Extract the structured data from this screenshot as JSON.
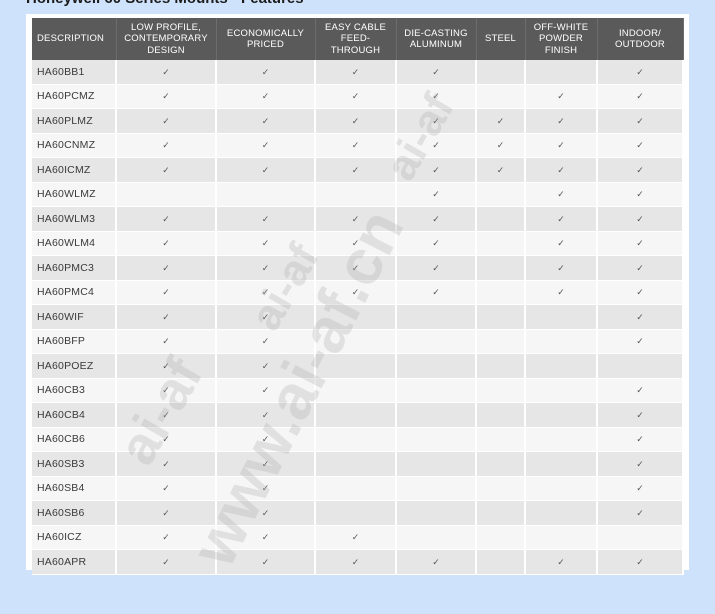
{
  "heading": "Honeywell 60 Series Mounts - Features",
  "table": {
    "columns": [
      "DESCRIPTION",
      "LOW PROFILE, CONTEMPORARY DESIGN",
      "ECONOMICALLY PRICED",
      "EASY CABLE FEED-THROUGH",
      "DIE-CASTING ALUMINUM",
      "STEEL",
      "OFF-WHITE POWDER FINISH",
      "INDOOR/ OUTDOOR"
    ],
    "check_symbol": "✓",
    "rows": [
      {
        "model": "HA60BB1",
        "checks": [
          1,
          1,
          1,
          1,
          0,
          0,
          1
        ]
      },
      {
        "model": "HA60PCMZ",
        "checks": [
          1,
          1,
          1,
          1,
          0,
          1,
          1
        ]
      },
      {
        "model": "HA60PLMZ",
        "checks": [
          1,
          1,
          1,
          1,
          1,
          1,
          1
        ]
      },
      {
        "model": "HA60CNMZ",
        "checks": [
          1,
          1,
          1,
          1,
          1,
          1,
          1
        ]
      },
      {
        "model": "HA60ICMZ",
        "checks": [
          1,
          1,
          1,
          1,
          1,
          1,
          1
        ]
      },
      {
        "model": "HA60WLMZ",
        "checks": [
          0,
          0,
          0,
          1,
          0,
          1,
          1
        ]
      },
      {
        "model": "HA60WLM3",
        "checks": [
          1,
          1,
          1,
          1,
          0,
          1,
          1
        ]
      },
      {
        "model": "HA60WLM4",
        "checks": [
          1,
          1,
          1,
          1,
          0,
          1,
          1
        ]
      },
      {
        "model": "HA60PMC3",
        "checks": [
          1,
          1,
          1,
          1,
          0,
          1,
          1
        ]
      },
      {
        "model": "HA60PMC4",
        "checks": [
          1,
          1,
          1,
          1,
          0,
          1,
          1
        ]
      },
      {
        "model": "HA60WIF",
        "checks": [
          1,
          1,
          0,
          0,
          0,
          0,
          1
        ]
      },
      {
        "model": "HA60BFP",
        "checks": [
          1,
          1,
          0,
          0,
          0,
          0,
          1
        ]
      },
      {
        "model": "HA60POEZ",
        "checks": [
          1,
          1,
          0,
          0,
          0,
          0,
          0
        ]
      },
      {
        "model": "HA60CB3",
        "checks": [
          1,
          1,
          0,
          0,
          0,
          0,
          1
        ]
      },
      {
        "model": "HA60CB4",
        "checks": [
          1,
          1,
          0,
          0,
          0,
          0,
          1
        ]
      },
      {
        "model": "HA60CB6",
        "checks": [
          1,
          1,
          0,
          0,
          0,
          0,
          1
        ]
      },
      {
        "model": "HA60SB3",
        "checks": [
          1,
          1,
          0,
          0,
          0,
          0,
          1
        ]
      },
      {
        "model": "HA60SB4",
        "checks": [
          1,
          1,
          0,
          0,
          0,
          0,
          1
        ]
      },
      {
        "model": "HA60SB6",
        "checks": [
          1,
          1,
          0,
          0,
          0,
          0,
          1
        ]
      },
      {
        "model": "HA60ICZ",
        "checks": [
          1,
          1,
          1,
          0,
          0,
          0,
          0
        ]
      },
      {
        "model": "HA60APR",
        "checks": [
          1,
          1,
          1,
          1,
          0,
          1,
          1
        ]
      }
    ]
  },
  "watermark": {
    "main": "www.ai-af.cn",
    "small": "ai-af"
  }
}
